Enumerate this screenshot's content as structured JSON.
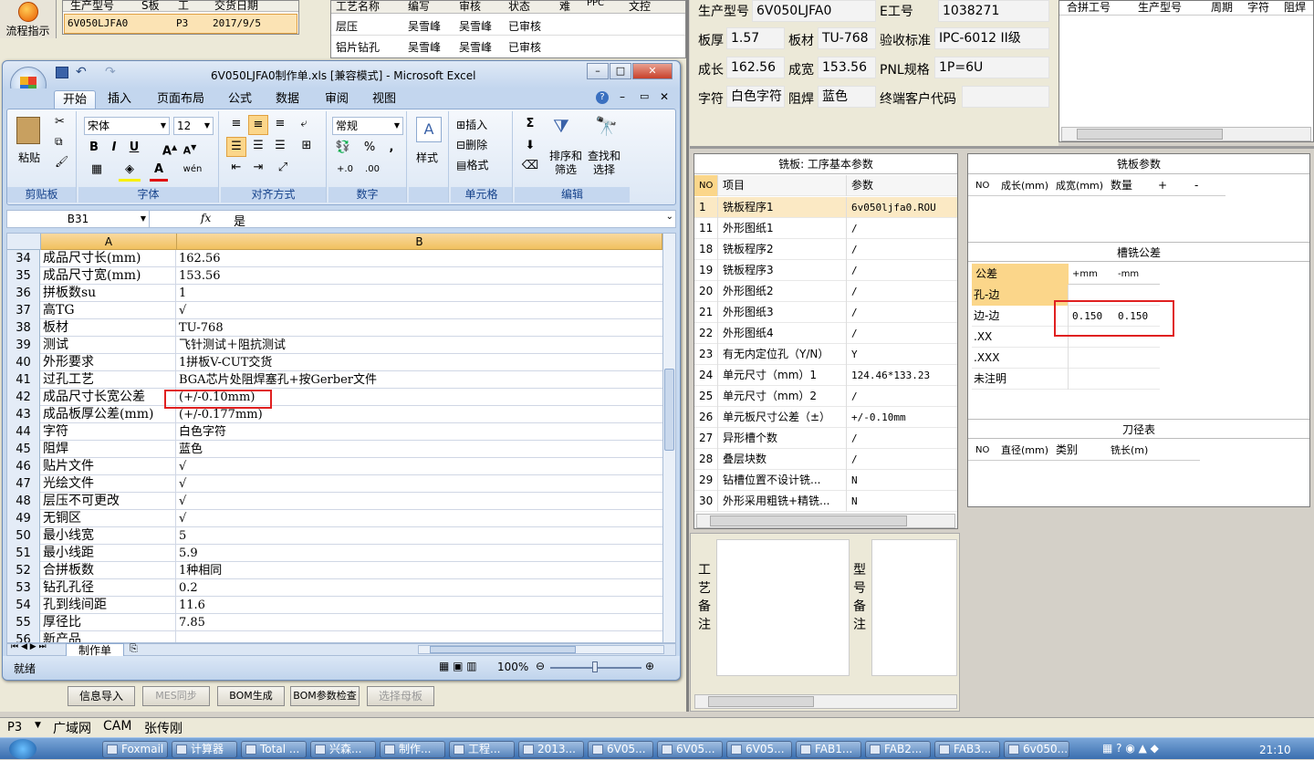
{
  "top_left": {
    "flow_button": "流程指示",
    "order_table": {
      "headers": [
        "生产型号",
        "S板",
        "工",
        "交货日期"
      ],
      "row": [
        "6V050LJFA0",
        "P3",
        "2017/9/5"
      ]
    },
    "process_table": {
      "headers": [
        "工艺名称",
        "编写",
        "审核",
        "状态",
        "难",
        "PPC",
        "文控"
      ],
      "rows": [
        [
          "层压",
          "吴雪峰",
          "吴雪峰",
          "已审核"
        ],
        [
          "铝片钻孔",
          "吴雪峰",
          "吴雪峰",
          "已审核"
        ]
      ]
    }
  },
  "excel": {
    "title": "6V050LJFA0制作单.xls [兼容模式] - Microsoft Excel",
    "tabs": [
      "开始",
      "插入",
      "页面布局",
      "公式",
      "数据",
      "审阅",
      "视图"
    ],
    "clipboard": {
      "paste": "粘贴",
      "label": "剪贴板"
    },
    "font": {
      "name": "宋体",
      "size": "12",
      "label": "字体",
      "bold": "B",
      "italic": "I",
      "underline": "U"
    },
    "align": {
      "label": "对齐方式"
    },
    "number": {
      "format": "常规",
      "label": "数字",
      "percent": "%",
      "comma": ","
    },
    "styles": {
      "label": "样式"
    },
    "cells": {
      "insert": "插入",
      "delete": "删除",
      "format": "格式",
      "label": "单元格"
    },
    "editing": {
      "sort": "排序和\n筛选",
      "find": "查找和\n选择",
      "label": "编辑",
      "sigma": "Σ"
    },
    "name_box": "B31",
    "fx": "fx",
    "formula": "是",
    "col_a": "A",
    "col_b": "B",
    "rows": [
      {
        "n": "34",
        "a": "成品尺寸长(mm)",
        "b": "162.56"
      },
      {
        "n": "35",
        "a": "成品尺寸宽(mm)",
        "b": "153.56"
      },
      {
        "n": "36",
        "a": "拼板数su",
        "b": "1"
      },
      {
        "n": "37",
        "a": "高TG",
        "b": "√"
      },
      {
        "n": "38",
        "a": "板材",
        "b": "TU-768"
      },
      {
        "n": "39",
        "a": "测试",
        "b": "飞针测试＋阻抗测试"
      },
      {
        "n": "40",
        "a": "外形要求",
        "b": "1拼板V-CUT交货"
      },
      {
        "n": "41",
        "a": "过孔工艺",
        "b": "BGA芯片处阻焊塞孔+按Gerber文件"
      },
      {
        "n": "42",
        "a": "成品尺寸长宽公差",
        "b": "(+/-0.10mm)"
      },
      {
        "n": "43",
        "a": "成品板厚公差(mm)",
        "b": "(+/-0.177mm)"
      },
      {
        "n": "44",
        "a": "字符",
        "b": "白色字符"
      },
      {
        "n": "45",
        "a": "阻焊",
        "b": "蓝色"
      },
      {
        "n": "46",
        "a": "贴片文件",
        "b": "√"
      },
      {
        "n": "47",
        "a": "光绘文件",
        "b": "√"
      },
      {
        "n": "48",
        "a": "层压不可更改",
        "b": "√"
      },
      {
        "n": "49",
        "a": "无铜区",
        "b": "√"
      },
      {
        "n": "50",
        "a": "最小线宽",
        "b": "5"
      },
      {
        "n": "51",
        "a": "最小线距",
        "b": "5.9"
      },
      {
        "n": "52",
        "a": "合拼板数",
        "b": "1种相同"
      },
      {
        "n": "53",
        "a": "钻孔孔径",
        "b": "0.2"
      },
      {
        "n": "54",
        "a": "孔到线间距",
        "b": "11.6"
      },
      {
        "n": "55",
        "a": "厚径比",
        "b": "7.85"
      },
      {
        "n": "56",
        "a": "新产品",
        "b": ""
      }
    ],
    "sheet_tab": "制作单",
    "status": "就绪",
    "zoom": "100%"
  },
  "buttons": [
    "信息导入",
    "MES同步",
    "BOM生成",
    "BOM参数检查",
    "选择母板"
  ],
  "header_fields": [
    {
      "label": "生产型号",
      "value": "6V050LJFA0"
    },
    {
      "label": "E工号",
      "value": "1038271"
    },
    {
      "label": "板厚",
      "value": "1.57"
    },
    {
      "label": "板材",
      "value": "TU-768"
    },
    {
      "label": "验收标准",
      "value": "IPC-6012 II级"
    },
    {
      "label": "成长",
      "value": "162.56"
    },
    {
      "label": "成宽",
      "value": "153.56"
    },
    {
      "label": "PNL规格",
      "value": "1P=6U"
    },
    {
      "label": "字符",
      "value": "白色字符"
    },
    {
      "label": "阻焊",
      "value": "蓝色"
    },
    {
      "label": "终端客户代码",
      "value": ""
    }
  ],
  "merge_table": {
    "headers": [
      "合拼工号",
      "生产型号",
      "周期",
      "字符",
      "阻焊"
    ]
  },
  "milling_params_main": {
    "title": "铣板: 工序基本参数",
    "headers": [
      "NO",
      "项目",
      "参数"
    ],
    "rows": [
      [
        "1",
        "铣板程序1",
        "6v050ljfa0.ROU"
      ],
      [
        "11",
        "外形图纸1",
        "/"
      ],
      [
        "18",
        "铣板程序2",
        "/"
      ],
      [
        "19",
        "铣板程序3",
        "/"
      ],
      [
        "20",
        "外形图纸2",
        "/"
      ],
      [
        "21",
        "外形图纸3",
        "/"
      ],
      [
        "22",
        "外形图纸4",
        "/"
      ],
      [
        "23",
        "有无内定位孔（Y/N）",
        "Y"
      ],
      [
        "24",
        "单元尺寸（mm）1",
        "124.46*133.23"
      ],
      [
        "25",
        "单元尺寸（mm）2",
        "/"
      ],
      [
        "26",
        "单元板尺寸公差（±）",
        "+/-0.10mm"
      ],
      [
        "27",
        "异形槽个数",
        "/"
      ],
      [
        "28",
        "叠层块数",
        "/"
      ],
      [
        "29",
        "钻槽位置不设计铣...",
        "N"
      ],
      [
        "30",
        "外形采用粗铣+精铣...",
        "N"
      ]
    ]
  },
  "milling_params": {
    "title": "铣板参数",
    "headers": [
      "NO",
      "成长(mm)",
      "成宽(mm)",
      "数量",
      "+",
      "-"
    ]
  },
  "slot_tolerance": {
    "title": "槽铣公差",
    "headers": [
      "公差",
      "+mm",
      "-mm"
    ],
    "rows": [
      [
        "孔-边",
        "",
        ""
      ],
      [
        "边-边",
        "0.150",
        "0.150"
      ],
      [
        ".XX",
        "",
        ""
      ],
      [
        ".XXX",
        "",
        ""
      ],
      [
        "未注明",
        "",
        ""
      ]
    ]
  },
  "tool_table": {
    "title": "刀径表",
    "headers": [
      "NO",
      "直径(mm)",
      "类别",
      "铣长(m)"
    ]
  },
  "notes": {
    "process": "工\n艺\n备\n注",
    "model": "型\n号\n备\n注"
  },
  "bottom_bar": [
    "P3",
    "广域网",
    "CAM",
    "张传刚"
  ],
  "taskbar": {
    "items": [
      "Foxmail",
      "计算器",
      "Total ...",
      "兴森...",
      "制作...",
      "工程...",
      "2013...",
      "6V05...",
      "6V05...",
      "6V05...",
      "FAB1...",
      "FAB2...",
      "FAB3...",
      "6v050..."
    ],
    "clock": "21:10"
  },
  "colors": {
    "accent": "#f1c15f",
    "selection_red": "#e02020",
    "ribbon": "#dce7f5"
  }
}
